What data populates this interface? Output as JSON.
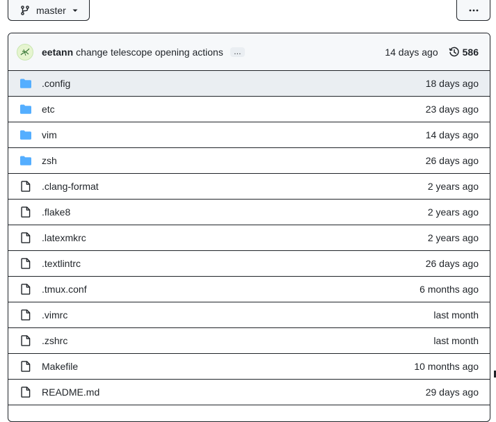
{
  "branch": {
    "label": "master"
  },
  "commit": {
    "author": "eetann",
    "message": "change telescope opening actions",
    "ellipsis": "…",
    "time": "14 days ago",
    "count": "586"
  },
  "files": [
    {
      "type": "folder",
      "name": ".config",
      "time": "18 days ago",
      "highlight": true
    },
    {
      "type": "folder",
      "name": "etc",
      "time": "23 days ago"
    },
    {
      "type": "folder",
      "name": "vim",
      "time": "14 days ago"
    },
    {
      "type": "folder",
      "name": "zsh",
      "time": "26 days ago"
    },
    {
      "type": "file",
      "name": ".clang-format",
      "time": "2 years ago"
    },
    {
      "type": "file",
      "name": ".flake8",
      "time": "2 years ago"
    },
    {
      "type": "file",
      "name": ".latexmkrc",
      "time": "2 years ago"
    },
    {
      "type": "file",
      "name": ".textlintrc",
      "time": "26 days ago"
    },
    {
      "type": "file",
      "name": ".tmux.conf",
      "time": "6 months ago"
    },
    {
      "type": "file",
      "name": ".vimrc",
      "time": "last month"
    },
    {
      "type": "file",
      "name": ".zshrc",
      "time": "last month"
    },
    {
      "type": "file",
      "name": "Makefile",
      "time": "10 months ago"
    },
    {
      "type": "file",
      "name": "README.md",
      "time": "29 days ago"
    }
  ],
  "colors": {
    "folder": "#54aeff",
    "border": "#1f2328",
    "header_bg": "#f6f8fa",
    "highlight_bg": "#eaeef2"
  },
  "icons": {
    "branch": "git-branch-icon",
    "caret": "caret-down-icon",
    "more": "kebab-horizontal-icon",
    "history": "history-icon",
    "folder": "folder-icon",
    "file": "file-icon"
  }
}
